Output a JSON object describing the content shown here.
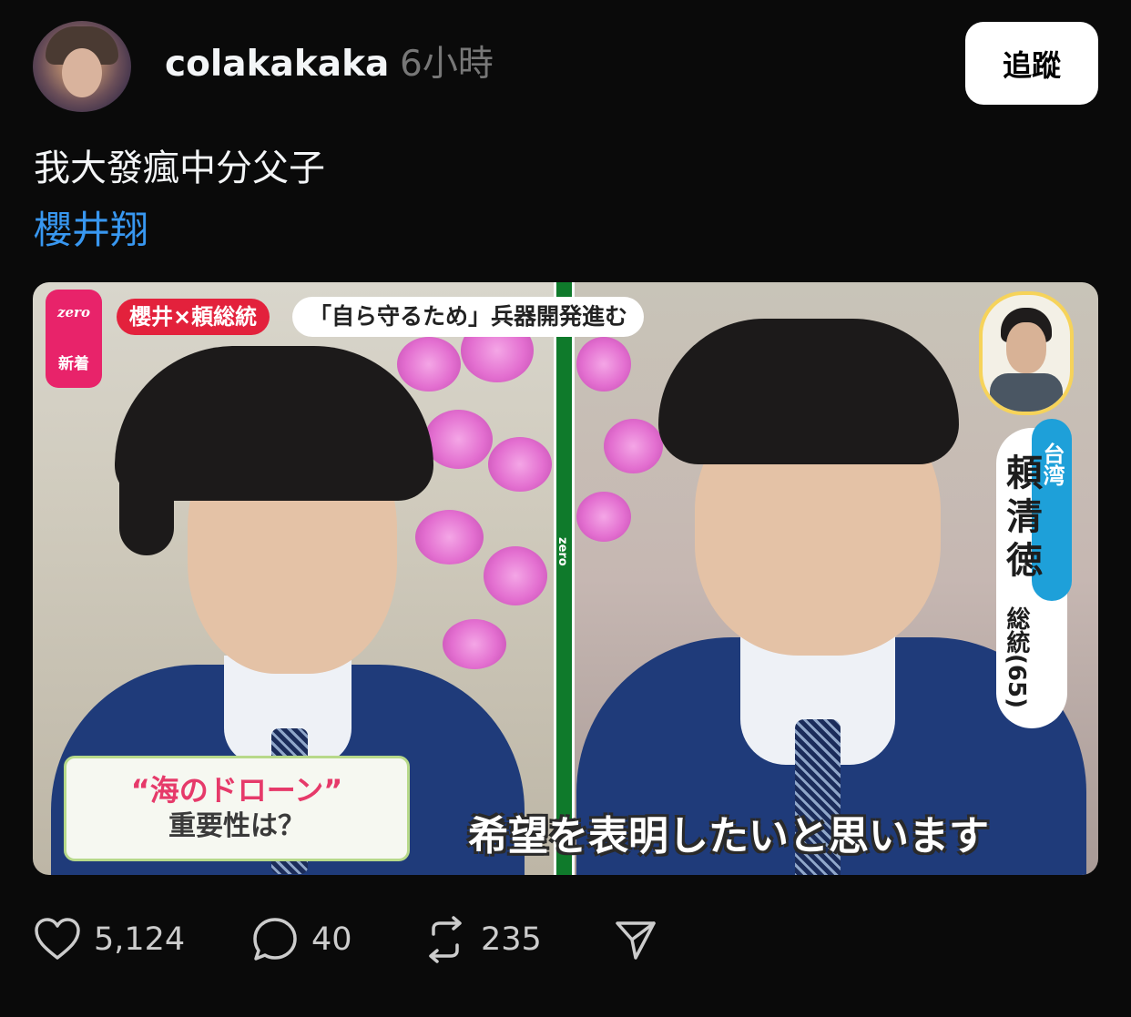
{
  "post": {
    "username": "colakakaka",
    "timestamp": "6小時",
    "follow_label": "追蹤",
    "text": "我大發瘋中分父子",
    "tag": "櫻井翔"
  },
  "media": {
    "logo_text": "zero",
    "new_badge": "新着",
    "topic_red": "櫻井×頼総統",
    "topic_white": "「自ら守るため」兵器開発進む",
    "name_country": "台湾",
    "name_main": "頼清徳",
    "name_title": "総統(65)",
    "question_line1": "“海のドローン”",
    "question_line2": "重要性は？",
    "subtitle": "希望を表明したいと思います"
  },
  "actions": {
    "likes": "5,124",
    "replies": "40",
    "reposts": "235"
  },
  "colors": {
    "background": "#0a0a0a",
    "link": "#3897f0",
    "muted": "#777777"
  },
  "icons": [
    "heart-icon",
    "comment-icon",
    "repost-icon",
    "share-icon"
  ]
}
